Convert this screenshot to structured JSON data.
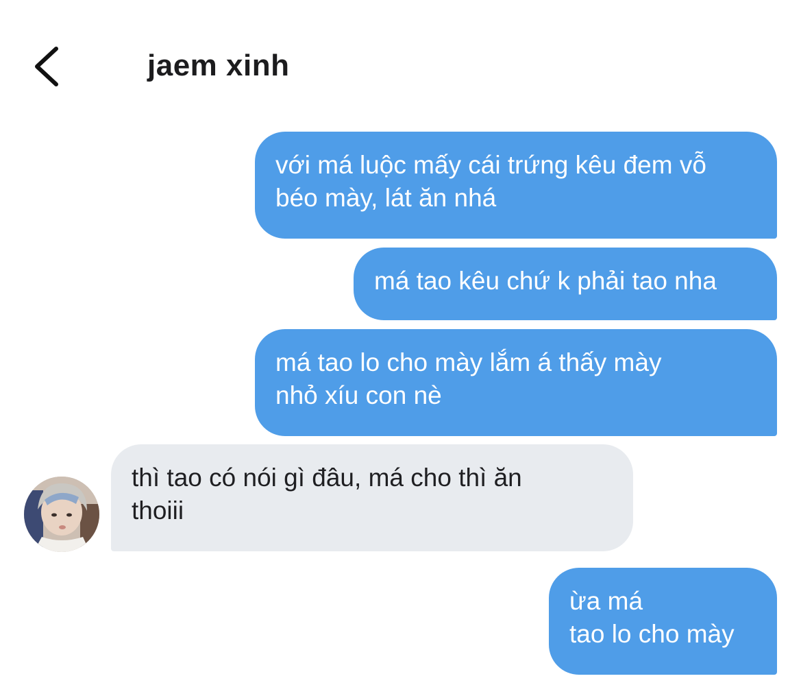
{
  "header": {
    "back_icon": "chevron-left-icon",
    "title": "jaem xinh"
  },
  "messages": [
    {
      "direction": "outgoing",
      "text": "với má luộc mấy cái trứng kêu đem vỗ\nbéo mày, lát ăn nhá"
    },
    {
      "direction": "outgoing",
      "text": "má tao kêu chứ k phải tao nha"
    },
    {
      "direction": "outgoing",
      "text": "má tao lo cho mày lắm á thấy mày\nnhỏ xíu con nè"
    },
    {
      "direction": "incoming",
      "text": "thì tao có nói gì đâu, má cho thì ăn\nthoiii"
    },
    {
      "direction": "outgoing",
      "text": "ừa má\ntao lo cho mày"
    }
  ],
  "colors": {
    "outgoing_bubble": "#4f9de8",
    "incoming_bubble": "#e8ebef",
    "outgoing_text": "#ffffff",
    "incoming_text": "#1f1f22"
  }
}
